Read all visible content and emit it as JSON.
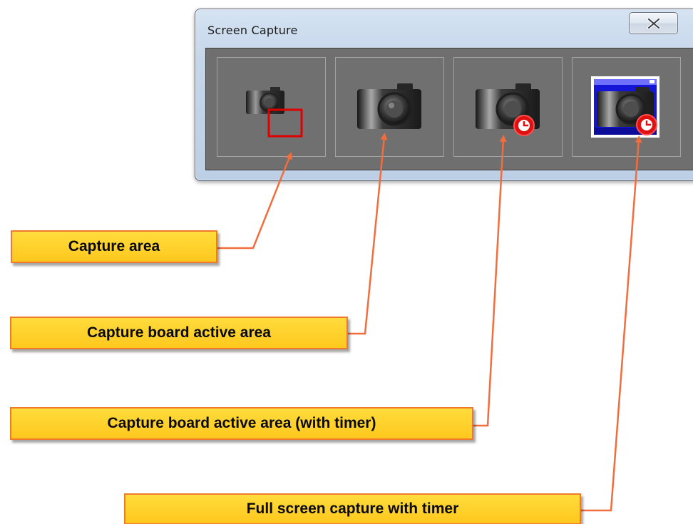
{
  "window": {
    "title": "Screen Capture",
    "close_icon": "close-x-icon"
  },
  "tools": [
    {
      "name": "capture-area-button",
      "icon": "camera-selection-icon"
    },
    {
      "name": "capture-board-active-area-button",
      "icon": "camera-icon"
    },
    {
      "name": "capture-board-active-area-timer-button",
      "icon": "camera-timer-icon"
    },
    {
      "name": "full-screen-capture-timer-button",
      "icon": "screen-camera-timer-icon"
    }
  ],
  "callouts": {
    "capture_area": "Capture area",
    "board_active_area": "Capture board active area",
    "board_active_area_timer": "Capture board active area (with timer)",
    "full_screen_timer": "Full screen capture with timer"
  },
  "colors": {
    "callout_fill": "#ffc81e",
    "callout_border": "#f07a2c",
    "arrow": "#f26d3d",
    "panel": "#6f6f6f",
    "selection_rect": "#e00000",
    "timer_badge": "#e01010",
    "screen_blue": "#1515d8"
  }
}
